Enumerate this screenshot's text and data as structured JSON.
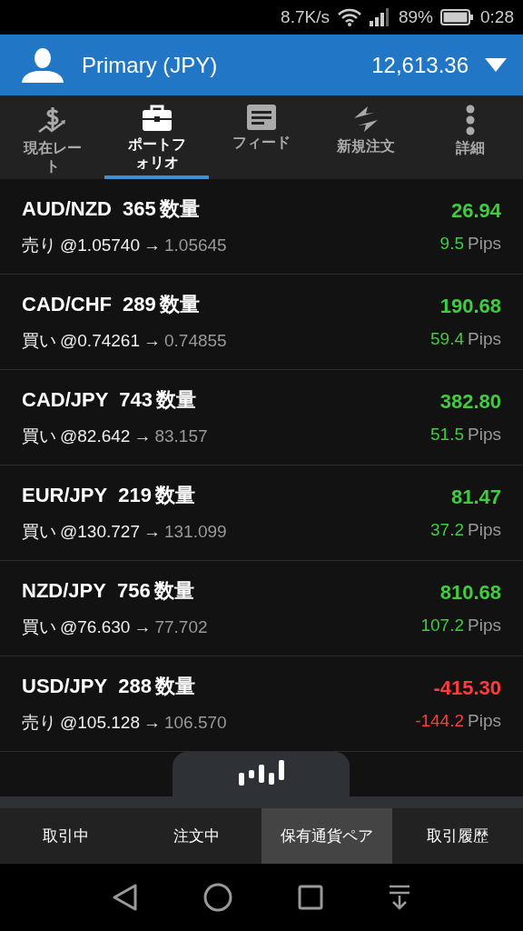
{
  "status_bar": {
    "speed": "8.7K/s",
    "battery": "89%",
    "time": "0:28"
  },
  "header": {
    "account": "Primary (JPY)",
    "balance": "12,613.36"
  },
  "tabs": [
    {
      "kind": "rates",
      "label": "現在レート",
      "selected": false
    },
    {
      "kind": "portfolio",
      "label": "ポートフォリオ",
      "selected": true
    },
    {
      "kind": "feed",
      "label": "フィード",
      "selected": false
    },
    {
      "kind": "order",
      "label": "新規注文",
      "selected": false
    },
    {
      "kind": "more",
      "label": "詳細",
      "selected": false
    }
  ],
  "positions": [
    {
      "pair": "AUD/NZD",
      "quantity": "365",
      "unit": "数量",
      "side": "売り",
      "open": "@1.05740",
      "arrow": "→",
      "current": "1.05645",
      "profit": "26.94",
      "pips": "9.5",
      "pips_unit": "Pips",
      "kind": "gain"
    },
    {
      "pair": "CAD/CHF",
      "quantity": "289",
      "unit": "数量",
      "side": "買い",
      "open": "@0.74261",
      "arrow": "→",
      "current": "0.74855",
      "profit": "190.68",
      "pips": "59.4",
      "pips_unit": "Pips",
      "kind": "gain"
    },
    {
      "pair": "CAD/JPY",
      "quantity": "743",
      "unit": "数量",
      "side": "買い",
      "open": "@82.642",
      "arrow": "→",
      "current": "83.157",
      "profit": "382.80",
      "pips": "51.5",
      "pips_unit": "Pips",
      "kind": "gain"
    },
    {
      "pair": "EUR/JPY",
      "quantity": "219",
      "unit": "数量",
      "side": "買い",
      "open": "@130.727",
      "arrow": "→",
      "current": "131.099",
      "profit": "81.47",
      "pips": "37.2",
      "pips_unit": "Pips",
      "kind": "gain"
    },
    {
      "pair": "NZD/JPY",
      "quantity": "756",
      "unit": "数量",
      "side": "買い",
      "open": "@76.630",
      "arrow": "→",
      "current": "77.702",
      "profit": "810.68",
      "pips": "107.2",
      "pips_unit": "Pips",
      "kind": "gain"
    },
    {
      "pair": "USD/JPY",
      "quantity": "288",
      "unit": "数量",
      "side": "売り",
      "open": "@105.128",
      "arrow": "→",
      "current": "106.570",
      "profit": "-415.30",
      "pips": "-144.2",
      "pips_unit": "Pips",
      "kind": "loss"
    }
  ],
  "bottom_tabs": [
    {
      "label": "取引中",
      "selected": false
    },
    {
      "label": "注文中",
      "selected": false
    },
    {
      "label": "保有通貨ペア",
      "selected": true
    },
    {
      "label": "取引履歴",
      "selected": false
    }
  ]
}
